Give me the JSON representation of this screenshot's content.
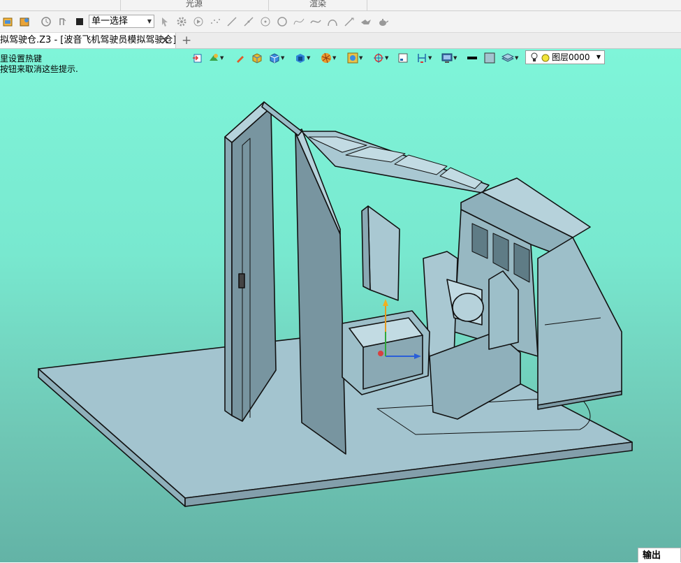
{
  "ribbon": {
    "groups": [
      {
        "label": "光源"
      },
      {
        "label": "渲染"
      }
    ]
  },
  "toolbar": {
    "selection_mode": "单一选择",
    "icons": [
      "open-file-icon",
      "save-icon",
      "history-icon",
      "undo-icon",
      "stop-icon",
      "pointer-icon",
      "gear-icon",
      "play-icon",
      "point-cloud-icon",
      "line-icon",
      "line-segment-icon",
      "point-circle-icon",
      "circle-icon",
      "spline-icon",
      "curve-icon",
      "arc-icon",
      "sketch-line-icon",
      "bird-icon",
      "teapot-icon"
    ]
  },
  "tabs": {
    "document_title": "拟驾驶仓.Z3 - [波音飞机驾驶员模拟驾驶仓]",
    "close_glyph": "✕",
    "new_tab_glyph": "+"
  },
  "viewport": {
    "hints": [
      "里设置热键",
      "按钮来取消这些提示."
    ],
    "layer": {
      "label": "图层0000"
    },
    "background_top": "#7ff5d9",
    "background_bottom": "#63b3a6",
    "model_fill": "#a3c4cf"
  },
  "output_panel": {
    "label": "输出"
  }
}
